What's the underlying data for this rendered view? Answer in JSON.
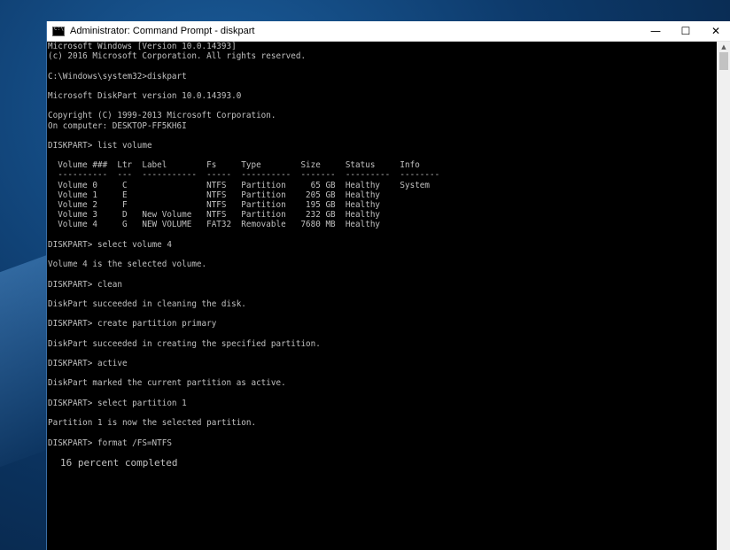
{
  "window": {
    "title": "Administrator: Command Prompt - diskpart",
    "minimize": "—",
    "maximize": "☐",
    "close": "✕"
  },
  "console": {
    "lines": [
      "Microsoft Windows [Version 10.0.14393]",
      "(c) 2016 Microsoft Corporation. All rights reserved.",
      "",
      "C:\\Windows\\system32>diskpart",
      "",
      "Microsoft DiskPart version 10.0.14393.0",
      "",
      "Copyright (C) 1999-2013 Microsoft Corporation.",
      "On computer: DESKTOP-FF5KH6I",
      "",
      "DISKPART> list volume",
      "",
      "  Volume ###  Ltr  Label        Fs     Type        Size     Status     Info",
      "  ----------  ---  -----------  -----  ----------  -------  ---------  --------",
      "  Volume 0     C                NTFS   Partition     65 GB  Healthy    System",
      "  Volume 1     E                NTFS   Partition    205 GB  Healthy",
      "  Volume 2     F                NTFS   Partition    195 GB  Healthy",
      "  Volume 3     D   New Volume   NTFS   Partition    232 GB  Healthy",
      "  Volume 4     G   NEW VOLUME   FAT32  Removable   7680 MB  Healthy",
      "",
      "DISKPART> select volume 4",
      "",
      "Volume 4 is the selected volume.",
      "",
      "DISKPART> clean",
      "",
      "DiskPart succeeded in cleaning the disk.",
      "",
      "DISKPART> create partition primary",
      "",
      "DiskPart succeeded in creating the specified partition.",
      "",
      "DISKPART> active",
      "",
      "DiskPart marked the current partition as active.",
      "",
      "DISKPART> select partition 1",
      "",
      "Partition 1 is now the selected partition.",
      "",
      "DISKPART> format /FS=NTFS"
    ],
    "progress_text": "16 percent completed"
  }
}
